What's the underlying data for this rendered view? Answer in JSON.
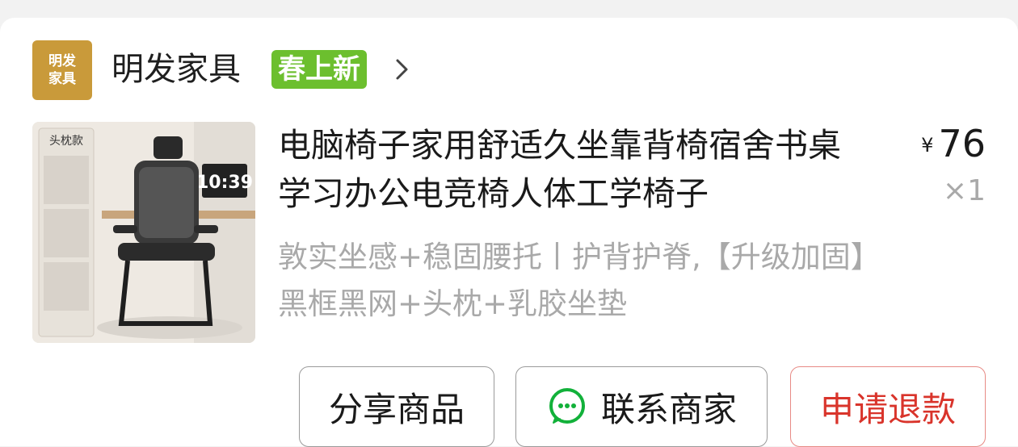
{
  "shop": {
    "logo_text": "明发\n家具",
    "name": "明发家具",
    "tag": "春上新",
    "chevron_icon": "chevron-right-icon"
  },
  "product": {
    "image_label": "头枕款",
    "image_clock": "10:39",
    "title": "电脑椅子家用舒适久坐靠背椅宿舍书桌学习办公电竞椅人体工学椅子",
    "price_symbol": "¥",
    "price": "76",
    "quantity": "×1",
    "spec": "敦实坐感+稳固腰托丨护背护脊,【升级加固】黑框黑网+头枕+乳胶坐垫"
  },
  "actions": {
    "share_label": "分享商品",
    "contact_label": "联系商家",
    "contact_icon": "wechat-chat-icon",
    "refund_label": "申请退款"
  },
  "colors": {
    "background": "#f2f2f2",
    "tag_green": "#6cbf2e",
    "logo_gold": "#c99a3a",
    "refund_red": "#d9342b",
    "muted_gray": "#a9a9a9"
  }
}
